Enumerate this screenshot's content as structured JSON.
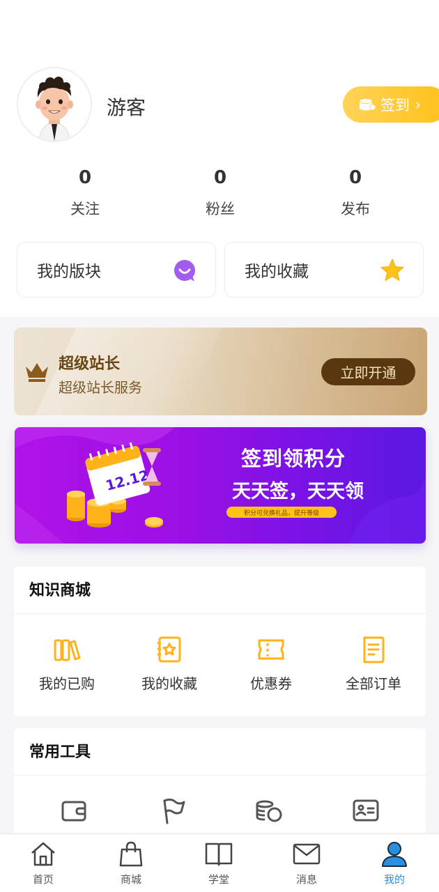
{
  "profile": {
    "username": "游客",
    "signin_label": "签到"
  },
  "stats": [
    {
      "value": "0",
      "label": "关注"
    },
    {
      "value": "0",
      "label": "粉丝"
    },
    {
      "value": "0",
      "label": "发布"
    }
  ],
  "quick_cards": [
    {
      "label": "我的版块",
      "icon": "chat-bubble-icon",
      "color": "#a35cf0"
    },
    {
      "label": "我的收藏",
      "icon": "star-icon",
      "color": "#ffc21a"
    }
  ],
  "vip": {
    "title": "超级站长",
    "subtitle": "超级站长服务",
    "button": "立即开通"
  },
  "banner": {
    "title": "签到领积分",
    "slogan": "天天签，天天领",
    "note": "积分可兑换礼品，提升等级",
    "calendar_text": "12.12"
  },
  "mall": {
    "title": "知识商城",
    "items": [
      {
        "label": "我的已购",
        "icon": "books-icon"
      },
      {
        "label": "我的收藏",
        "icon": "favorite-notebook-icon"
      },
      {
        "label": "优惠券",
        "icon": "coupon-icon"
      },
      {
        "label": "全部订单",
        "icon": "order-list-icon"
      }
    ]
  },
  "tools": {
    "title": "常用工具",
    "items": [
      {
        "icon": "wallet-icon"
      },
      {
        "icon": "flag-icon"
      },
      {
        "icon": "coins-icon"
      },
      {
        "icon": "id-card-icon"
      }
    ]
  },
  "tabbar": [
    {
      "label": "首页",
      "icon": "home-icon"
    },
    {
      "label": "商城",
      "icon": "shopping-bag-icon"
    },
    {
      "label": "学堂",
      "icon": "book-icon"
    },
    {
      "label": "消息",
      "icon": "mail-icon"
    },
    {
      "label": "我的",
      "icon": "user-icon",
      "active": true
    }
  ],
  "colors": {
    "accent": "#ffc21a",
    "active_tab": "#2a8fe0",
    "vip_button": "#5a380f",
    "banner_purple": "#9b10e4"
  }
}
